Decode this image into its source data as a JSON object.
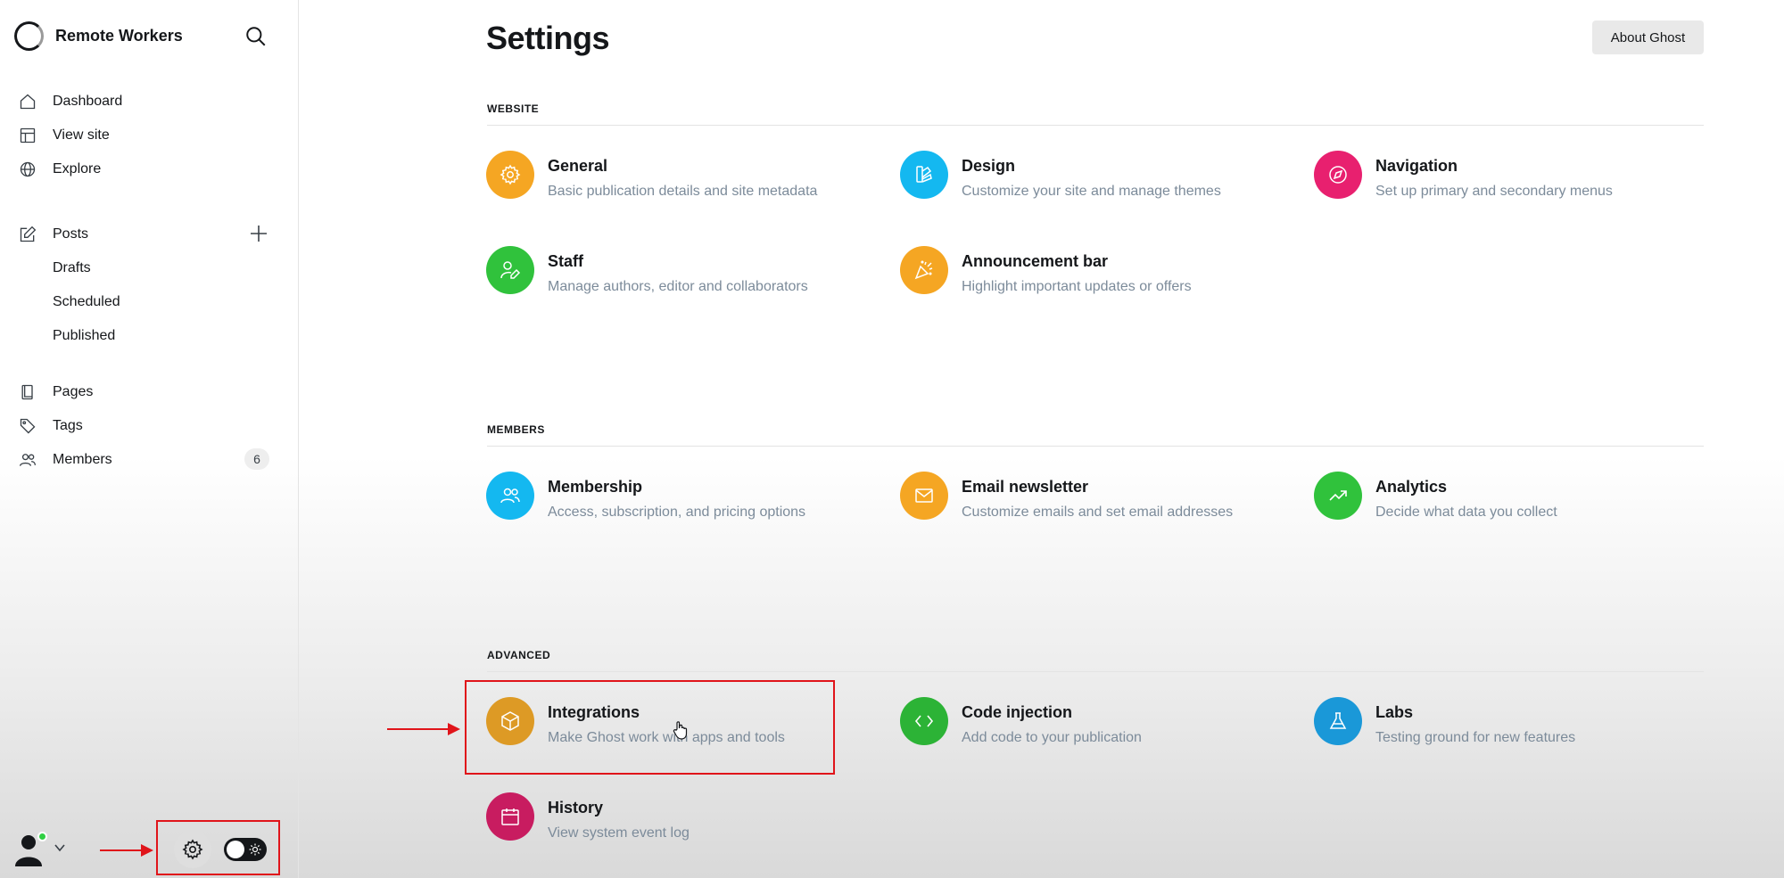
{
  "sidebar": {
    "site_name": "Remote Workers",
    "nav": {
      "dashboard": "Dashboard",
      "view_site": "View site",
      "explore": "Explore",
      "posts": "Posts",
      "drafts": "Drafts",
      "scheduled": "Scheduled",
      "published": "Published",
      "pages": "Pages",
      "tags": "Tags",
      "members": "Members",
      "members_count": "6"
    }
  },
  "header": {
    "title": "Settings",
    "about_button": "About Ghost"
  },
  "sections": {
    "website": {
      "label": "WEBSITE",
      "items": [
        {
          "title": "General",
          "desc": "Basic publication details and site metadata",
          "color": "#f5a623"
        },
        {
          "title": "Design",
          "desc": "Customize your site and manage themes",
          "color": "#14b8f0"
        },
        {
          "title": "Navigation",
          "desc": "Set up primary and secondary menus",
          "color": "#e8206f"
        },
        {
          "title": "Staff",
          "desc": "Manage authors, editor and collaborators",
          "color": "#30c23c"
        },
        {
          "title": "Announcement bar",
          "desc": "Highlight important updates or offers",
          "color": "#f5a623"
        }
      ]
    },
    "members": {
      "label": "MEMBERS",
      "items": [
        {
          "title": "Membership",
          "desc": "Access, subscription, and pricing options",
          "color": "#14b8f0"
        },
        {
          "title": "Email newsletter",
          "desc": "Customize emails and set email addresses",
          "color": "#f5a623"
        },
        {
          "title": "Analytics",
          "desc": "Decide what data you collect",
          "color": "#30c23c"
        }
      ]
    },
    "advanced": {
      "label": "ADVANCED",
      "items": [
        {
          "title": "Integrations",
          "desc": "Make Ghost work with apps and tools",
          "color": "#dd9a25"
        },
        {
          "title": "Code injection",
          "desc": "Add code to your publication",
          "color": "#2cb336"
        },
        {
          "title": "Labs",
          "desc": "Testing ground for new features",
          "color": "#1a98d8"
        },
        {
          "title": "History",
          "desc": "View system event log",
          "color": "#c81c60"
        }
      ]
    }
  },
  "icons": {
    "search": "search-icon",
    "dashboard": "home-icon",
    "view_site": "layout-icon",
    "explore": "globe-icon",
    "posts": "edit-icon",
    "add_post": "plus-icon",
    "pages": "page-icon",
    "tags": "tag-icon",
    "members": "users-icon",
    "settings": "gear-icon",
    "theme": "sun-icon"
  },
  "annotation_color": "#e0141a"
}
